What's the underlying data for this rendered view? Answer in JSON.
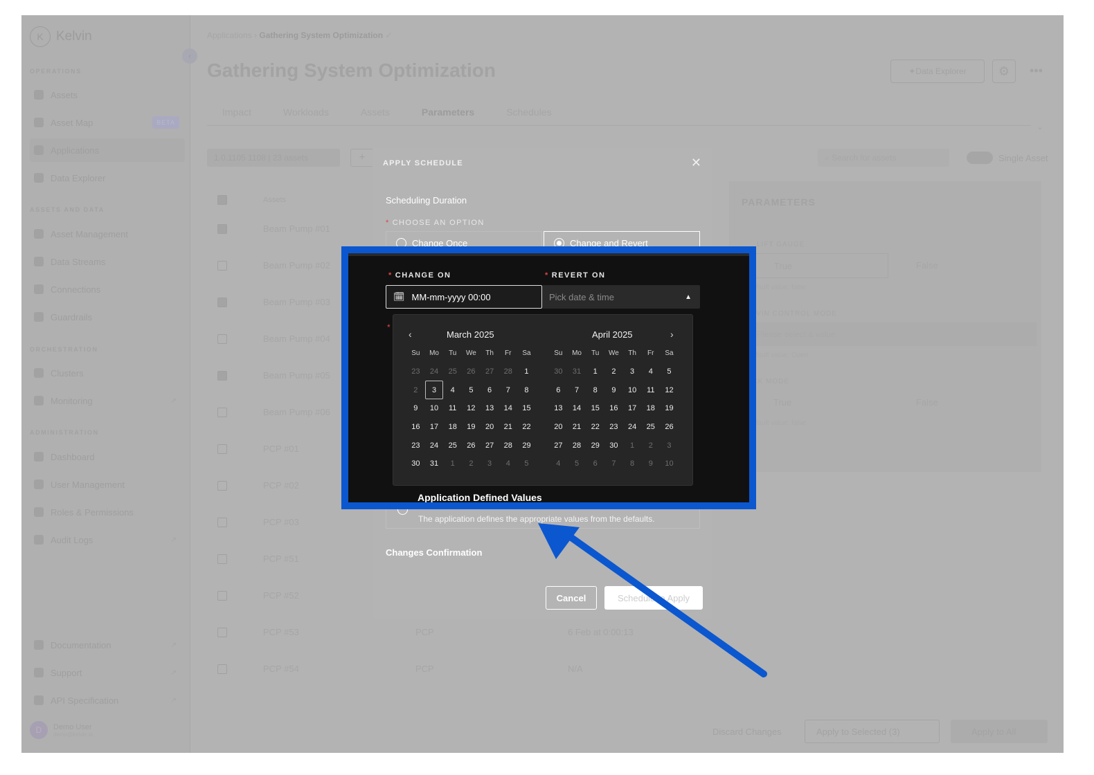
{
  "app": {
    "brand": "Kelvin"
  },
  "sidebar": {
    "sections": [
      "OPERATIONS",
      "ASSETS AND DATA",
      "ORCHESTRATION",
      "ADMINISTRATION"
    ],
    "operations": [
      "Assets",
      "Asset Map",
      "Applications",
      "Data Explorer"
    ],
    "asset_map_badge": "BETA",
    "assets_and_data": [
      "Asset Management",
      "Data Streams",
      "Connections",
      "Guardrails"
    ],
    "orchestration": [
      "Clusters",
      "Monitoring"
    ],
    "administration": [
      "Dashboard",
      "User Management",
      "Roles & Permissions",
      "Audit Logs"
    ],
    "footer": [
      "Documentation",
      "Support",
      "API Specification"
    ],
    "user": {
      "initial": "D",
      "name": "Demo User",
      "email": "demo@kelvin.ai"
    }
  },
  "header": {
    "breadcrumb_root": "Applications",
    "breadcrumb_current": "Gathering System Optimization",
    "title": "Gathering System Optimization",
    "data_explorer": "Data Explorer"
  },
  "tabs": [
    "Impact",
    "Workloads",
    "Assets",
    "Parameters",
    "Schedules"
  ],
  "toolbar": {
    "filter": "1.0.1105 1108 | 23 assets",
    "search_placeholder": "Search for assets",
    "single_asset": "Single Asset"
  },
  "table": {
    "header": "Assets",
    "rows": [
      {
        "name": "Beam Pump #01",
        "checked": true
      },
      {
        "name": "Beam Pump #02",
        "checked": false
      },
      {
        "name": "Beam Pump #03",
        "checked": true
      },
      {
        "name": "Beam Pump #04",
        "checked": false
      },
      {
        "name": "Beam Pump #05",
        "checked": true
      },
      {
        "name": "Beam Pump #06",
        "checked": false
      },
      {
        "name": "PCP #01",
        "checked": false
      },
      {
        "name": "PCP #02",
        "checked": false
      },
      {
        "name": "PCP #03",
        "checked": false
      },
      {
        "name": "PCP #51",
        "checked": false
      },
      {
        "name": "PCP #52",
        "checked": false
      },
      {
        "name": "PCP #53",
        "checked": false,
        "type": "PCP",
        "date": "6 Feb at 0:00:13"
      },
      {
        "name": "PCP #54",
        "checked": false,
        "type": "PCP",
        "date": "N/A"
      }
    ]
  },
  "params": {
    "title": "PARAMETERS",
    "label1": "LIFT GAUGE",
    "t1": "True",
    "f1": "False",
    "note1": "Default value: false",
    "label2": "KELVIN CONTROL MODE",
    "select2": "Please select a value",
    "note2": "Default value: Open",
    "label3": "LOCK MODE",
    "t3": "True",
    "f3": "False",
    "note3": "Default value: false"
  },
  "bottom": {
    "discard": "Discard Changes",
    "apply_selected": "Apply to Selected (3)",
    "apply_all": "Apply to All"
  },
  "dialog": {
    "title": "APPLY SCHEDULE",
    "scheduling_duration": "Scheduling Duration",
    "choose_option": "CHOOSE AN OPTION",
    "option_once": "Change Once",
    "option_revert": "Change and Revert",
    "change_on": "CHANGE ON",
    "revert_on": "REVERT ON",
    "change_on_value": "MM-mm-yyyy 00:00",
    "revert_placeholder": "Pick date & time",
    "adv_title": "Application Defined Values",
    "adv_desc": "The application defines the appropriate values from the defaults.",
    "changes_confirmation": "Changes Confirmation",
    "cancel": "Cancel",
    "apply": "Schedule to Apply"
  },
  "calendar": {
    "left_month": "March 2025",
    "right_month": "April 2025",
    "weekdays": [
      "Su",
      "Mo",
      "Tu",
      "We",
      "Th",
      "Fr",
      "Sa"
    ],
    "today": 3,
    "left_days": [
      [
        23,
        24,
        25,
        26,
        27,
        28,
        1
      ],
      [
        2,
        3,
        4,
        5,
        6,
        7,
        8
      ],
      [
        9,
        10,
        11,
        12,
        13,
        14,
        15
      ],
      [
        16,
        17,
        18,
        19,
        20,
        21,
        22
      ],
      [
        23,
        24,
        25,
        26,
        27,
        28,
        29
      ],
      [
        30,
        31,
        1,
        2,
        3,
        4,
        5
      ]
    ],
    "right_days": [
      [
        30,
        31,
        1,
        2,
        3,
        4,
        5
      ],
      [
        6,
        7,
        8,
        9,
        10,
        11,
        12
      ],
      [
        13,
        14,
        15,
        16,
        17,
        18,
        19
      ],
      [
        20,
        21,
        22,
        23,
        24,
        25,
        26
      ],
      [
        27,
        28,
        29,
        30,
        1,
        2,
        3
      ],
      [
        4,
        5,
        6,
        7,
        8,
        9,
        10
      ]
    ]
  },
  "colors": {
    "highlight_border": "#0b57d0",
    "arrow": "#0b57d0"
  }
}
